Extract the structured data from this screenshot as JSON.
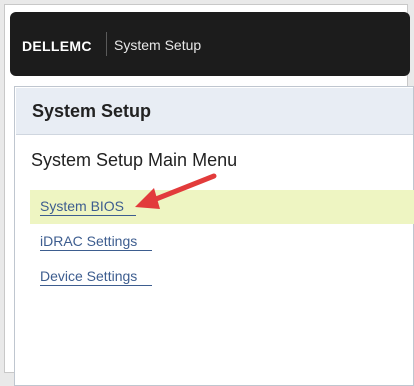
{
  "header": {
    "logo": "DELLEMC",
    "app_title": "System Setup"
  },
  "panel": {
    "title": "System Setup",
    "menu_title": "System Setup Main Menu",
    "items": [
      {
        "label": "System BIOS",
        "selected": true
      },
      {
        "label": "iDRAC Settings",
        "selected": false
      },
      {
        "label": "Device Settings",
        "selected": false
      }
    ]
  },
  "annotation": {
    "arrow_color": "#e23b3b"
  }
}
